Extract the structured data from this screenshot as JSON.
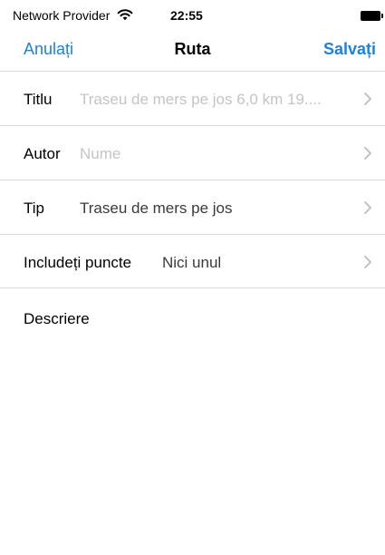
{
  "status_bar": {
    "carrier": "Network Provider",
    "time": "22:55"
  },
  "nav": {
    "cancel_label": "Anulați",
    "title": "Ruta",
    "save_label": "Salvați"
  },
  "form": {
    "rows": [
      {
        "label": "Titlu",
        "value": "Traseu de mers pe jos 6,0 km 19....",
        "is_placeholder": true
      },
      {
        "label": "Autor",
        "value": "Nume",
        "is_placeholder": true
      },
      {
        "label": "Tip",
        "value": "Traseu de mers pe jos",
        "is_placeholder": false
      },
      {
        "label": "Includeți puncte",
        "value": "Nici unul",
        "is_placeholder": false
      }
    ],
    "description_label": "Descriere"
  },
  "colors": {
    "accent": "#1a82e6",
    "separator": "#d9d9d9",
    "placeholder_text": "#c4c4c6",
    "value_text": "#3a3a3c"
  }
}
